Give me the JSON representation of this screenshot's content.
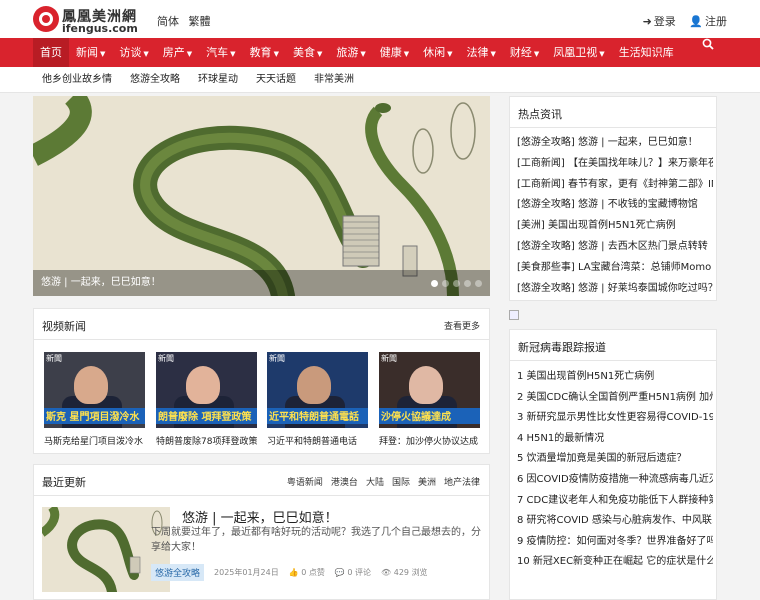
{
  "header": {
    "logo_cn": "鳳凰美洲網",
    "logo_en": "ifengus.com",
    "lang_simplified": "简体",
    "lang_traditional": "繁體",
    "login": "登录",
    "register": "注册"
  },
  "nav": {
    "items": [
      {
        "label": "首页",
        "caret": false
      },
      {
        "label": "新闻",
        "caret": true
      },
      {
        "label": "访谈",
        "caret": true
      },
      {
        "label": "房产",
        "caret": true
      },
      {
        "label": "汽车",
        "caret": true
      },
      {
        "label": "教育",
        "caret": true
      },
      {
        "label": "美食",
        "caret": true
      },
      {
        "label": "旅游",
        "caret": true
      },
      {
        "label": "健康",
        "caret": true
      },
      {
        "label": "休闲",
        "caret": true
      },
      {
        "label": "法律",
        "caret": true
      },
      {
        "label": "财经",
        "caret": true
      },
      {
        "label": "凤凰卫视",
        "caret": true
      },
      {
        "label": "生活知识库",
        "caret": false
      }
    ]
  },
  "subnav": {
    "items": [
      "他乡创业故乡情",
      "悠游全攻略",
      "环球星动",
      "天天话题",
      "非常美洲"
    ]
  },
  "slider": {
    "caption": "悠游 | 一起来，巳巳如意！"
  },
  "video_news": {
    "title": "视频新闻",
    "more": "查看更多",
    "videos": [
      {
        "title": "马斯克给星门项目泼冷水",
        "overlay": "斯克 星門項目潑冷水"
      },
      {
        "title": "特朗普废除78项拜登政策",
        "overlay": "朗普廢除 項拜登政策"
      },
      {
        "title": "习近平和特朗普通电话",
        "overlay": "近平和特朗普通電話"
      },
      {
        "title": "拜登：加沙停火协议达成",
        "overlay": "沙停火協議達成"
      }
    ],
    "tag": "新聞"
  },
  "updates": {
    "title": "最近更新",
    "tabs": [
      "粤语新闻",
      "港澳台",
      "大陆",
      "国际",
      "美洲",
      "地产法律"
    ],
    "article": {
      "title": "悠游 | 一起来，巳巳如意！",
      "desc": "下周就要过年了，最近都有啥好玩的活动呢？我选了几个自己最想去的，分享给大家！",
      "category": "悠游全攻略",
      "date": "2025年01月24日",
      "likes": "0 点赞",
      "comments": "0 评论",
      "views": "429 浏览"
    }
  },
  "hot_news": {
    "title": "热点资讯",
    "items": [
      "[悠游全攻略] 悠游 | 一起来，巳巳如意！",
      "[工商新闻] 【在美国找年味儿？】来万豪年夜...",
      "[工商新闻] 春节有家，更有《封神第二部》IM...",
      "[悠游全攻略] 悠游 | 不收钱的宝藏博物馆",
      "[美洲] 美国出现首例H5N1死亡病例",
      "[悠游全攻略] 悠游 | 去西木区热门景点转转",
      "[美食那些事] LA宝藏台湾菜：总铺师Momo Bi...",
      "[悠游全攻略] 悠游 | 好莱坞泰国城你吃过吗？"
    ]
  },
  "covid": {
    "title": "新冠病毒跟踪报道",
    "items": [
      "1 美国出现首例H5N1死亡病例",
      "2 美国CDC确认全国首例严重H5N1病例 加州...",
      "3 新研究显示男性比女性更容易得COVID-19...",
      "4 H5N1的最新情况",
      "5 饮酒量增加竟是美国的新冠后遗症？",
      "6 因COVID疫情防疫措施一种流感病毒几近灭...",
      "7 CDC建议老年人和免疫功能低下人群接种第...",
      "8 研究将COVID 感染与心脏病发作、中风联...",
      "9 疫情防控：如何面对冬季？世界准备好了吗？",
      "10 新冠XEC新变种正在崛起 它的症状是什么..."
    ]
  },
  "colors": {
    "brand_red": "#d9232d",
    "nav_active": "#b81c24",
    "badge_bg": "#d7e8f7"
  },
  "icons": {
    "login": "sign-in-icon",
    "register": "user-icon",
    "search": "search-icon",
    "likes": "thumbs-up-icon",
    "comments": "comment-icon",
    "views": "eye-icon"
  }
}
